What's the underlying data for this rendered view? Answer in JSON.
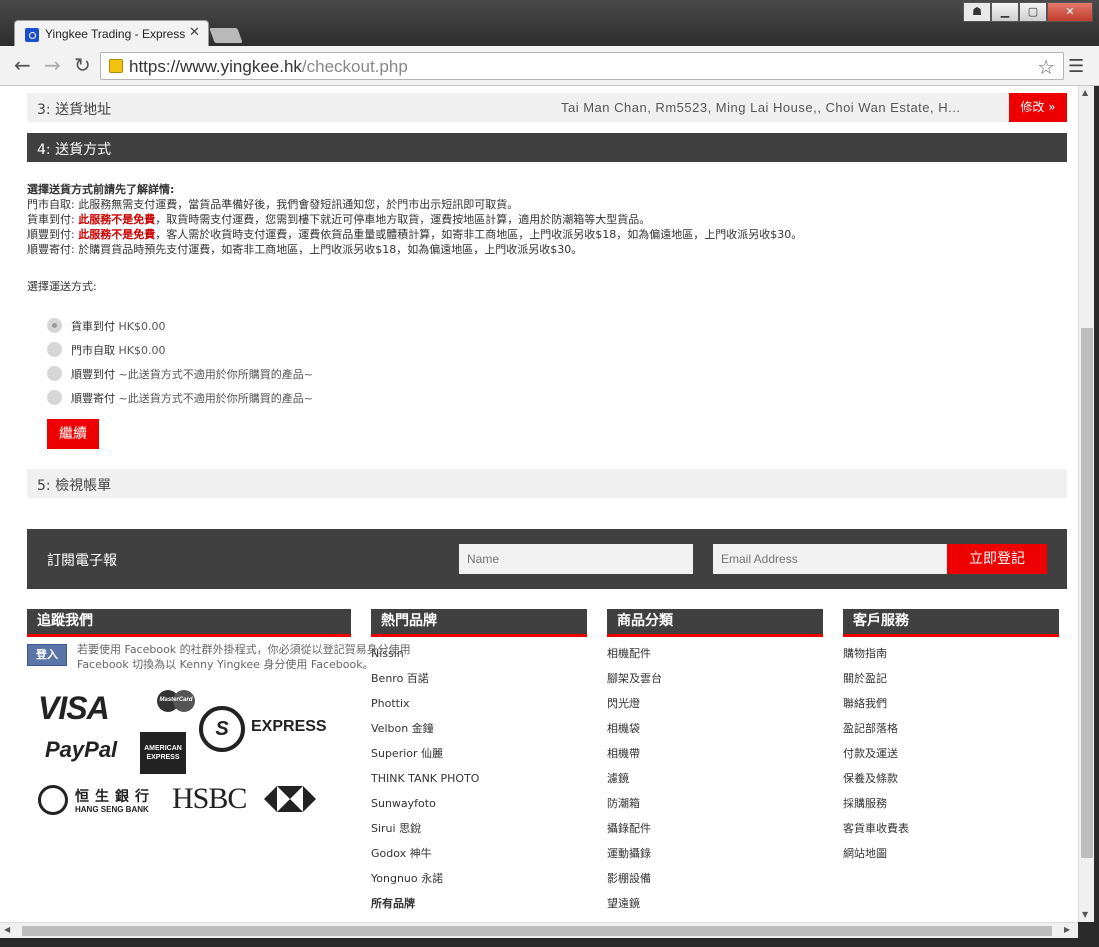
{
  "browser": {
    "tab_title": "Yingkee Trading - Express Checkout",
    "url_domain": "https://www.yingkee.hk",
    "url_path": "/checkout.php"
  },
  "step3": {
    "title": "3: 送貨地址",
    "address": "Tai Man Chan, Rm5523, Ming Lai House,, Choi Wan Estate, H...",
    "edit_label": "修改 »"
  },
  "step4": {
    "title": "4: 送貨方式",
    "info_head": "選擇送貨方式前請先了解詳情:",
    "line1": "門市自取: 此服務無需支付運費，當貨品準備好後，我們會發短訊通知您，於門市出示短訊即可取貨。",
    "line2_prefix": "貨車到付: ",
    "line2_red": "此服務不是免費",
    "line2_rest": "，取貨時需支付運費，您需到樓下就近可停車地方取貨，運費按地區計算，適用於防潮箱等大型貨品。",
    "line3_prefix": "順豐到付: ",
    "line3_red": "此服務不是免費",
    "line3_rest": "，客人需於收貨時支付運費，運費依貨品重量或體積計算，如寄非工商地區，上門收派另收$18，如為偏遠地區，上門收派另收$30。",
    "line4": "順豐寄付: 於購買貨品時預先支付運費，如寄非工商地區，上門收派另收$18，如為偏遠地區，上門收派另收$30。",
    "select_label": "選擇運送方式:",
    "options": [
      {
        "name": "貨車到付",
        "price": " HK$0.00"
      },
      {
        "name": "門市自取",
        "price": " HK$0.00"
      },
      {
        "name": "順豐到付",
        "price": " ~此送貨方式不適用於你所購買的產品~"
      },
      {
        "name": "順豐寄付",
        "price": " ~此送貨方式不適用於你所購買的產品~"
      }
    ],
    "continue_label": "繼續"
  },
  "step5": {
    "title": "5: 檢視帳單"
  },
  "newsletter": {
    "title": "訂閱電子報",
    "name_placeholder": "Name",
    "email_placeholder": "Email Address",
    "submit_label": "立即登記"
  },
  "footer": {
    "follow": {
      "title": "追蹤我們",
      "fb_login": "登入",
      "fb_text": "若要使用 Facebook 的社群外掛程式，你必須從以登記賀易身分使用 Facebook 切換為以 Kenny Yingkee 身分使用 Facebook。"
    },
    "logos": {
      "visa": "VISA",
      "mastercard": "MasterCard",
      "sf_mark": "S",
      "sf_text": "EXPRESS",
      "paypal": "PayPal",
      "amex": "AMERICAN EXPRESS",
      "hangseng_zh": "恒生銀行",
      "hangseng_en": "HANG SENG BANK",
      "hsbc": "HSBC"
    },
    "brands": {
      "title": "熱門品牌",
      "items": [
        "Nissin",
        "Benro 百諾",
        "Phottix",
        "Velbon 金鐘",
        "Superior 仙麗",
        "THINK TANK PHOTO",
        "Sunwayfoto",
        "Sirui 思銳",
        "Godox 神牛",
        "Yongnuo 永諾",
        "所有品牌"
      ]
    },
    "categories": {
      "title": "商品分類",
      "items": [
        "相機配件",
        "腳架及雲台",
        "閃光燈",
        "相機袋",
        "相機帶",
        "濾鏡",
        "防潮箱",
        "攝錄配件",
        "運動攝錄",
        "影棚設備",
        "望遠鏡"
      ]
    },
    "service": {
      "title": "客戶服務",
      "items": [
        "購物指南",
        "關於盈記",
        "聯絡我們",
        "盈記部落格",
        "付款及運送",
        "保養及條款",
        "採購服務",
        "客貨車收費表",
        "網站地圖"
      ]
    }
  }
}
